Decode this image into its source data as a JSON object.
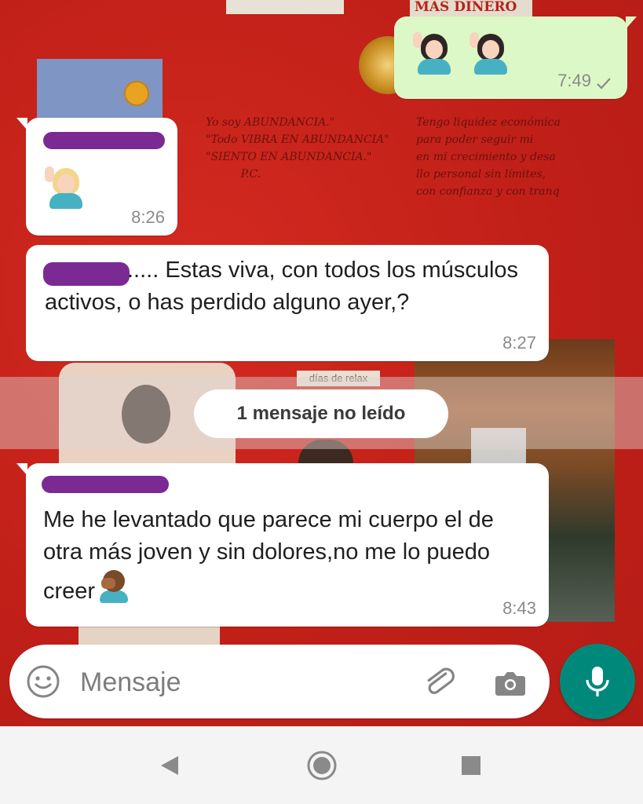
{
  "wallpaper": {
    "dinero_text": "MAS DINERO",
    "relax_text": "días de relax",
    "handwriting_left": "Yo soy ABUNDANCIA.\"\n\"Todo VIBRA EN ABUNDANCIA\"\n\"SIENTO EN ABUNDANCIA.\"\n          P.C.",
    "handwriting_right": "Tengo liquidez económica\npara poder seguir mi\nen mi crecimiento y desa\nllo personal sin límites,\ncon confianza y con tranq"
  },
  "messages": [
    {
      "direction": "outgoing",
      "emoji": [
        "woman-raising-hand-dark-hair",
        "woman-raising-hand-dark-hair"
      ],
      "time": "7:49",
      "status": "sent"
    },
    {
      "direction": "incoming",
      "sender_redacted": true,
      "emoji": [
        "woman-raising-hand-blonde"
      ],
      "time": "8:26"
    },
    {
      "direction": "incoming",
      "text": "..... Estas viva, con todos los músculos activos, o has perdido alguno ayer,?",
      "time": "8:27"
    },
    {
      "direction": "incoming",
      "sender_redacted": true,
      "text": "Me he levantado que parece mi cuerpo el de otra más joven y sin dolores,no me lo puedo creer",
      "trailing_emoji": "person-facepalming",
      "time": "8:43"
    }
  ],
  "unread_label": "1 mensaje no leído",
  "composer": {
    "placeholder": "Mensaje",
    "value": "",
    "icons": [
      "emoji-icon",
      "attach-icon",
      "camera-icon",
      "mic-icon"
    ]
  },
  "colors": {
    "incoming_bubble": "#ffffff",
    "outgoing_bubble": "#dcf8c6",
    "accent": "#00897b",
    "redaction": "#7b2a93"
  },
  "navbar": {
    "icons": [
      "back-icon",
      "home-icon",
      "recents-icon"
    ]
  }
}
